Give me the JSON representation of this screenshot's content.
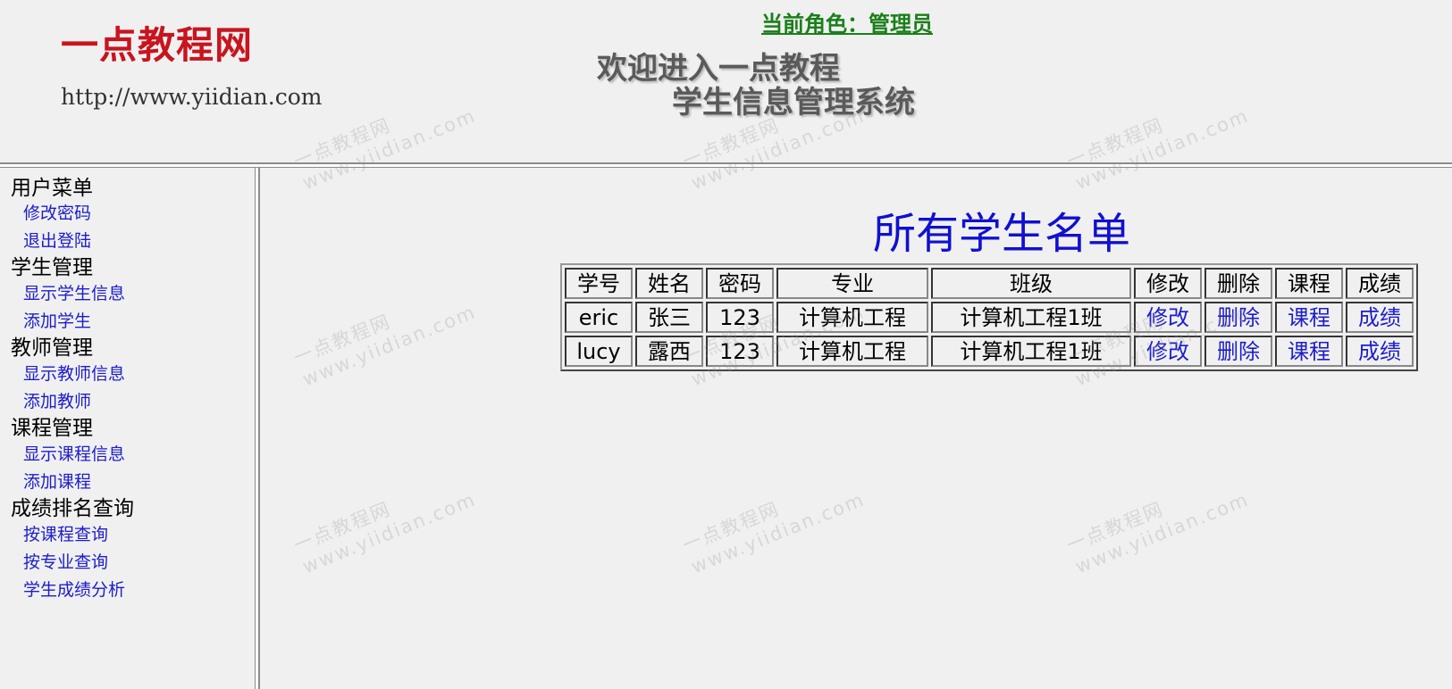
{
  "header": {
    "logo_title": "一点教程网",
    "logo_url": "http://www.yiidian.com",
    "role_label": "当前角色：管理员",
    "welcome_line1": "欢迎进入一点教程",
    "welcome_line2": "学生信息管理系统"
  },
  "menu": {
    "sections": [
      {
        "title": "用户菜单",
        "links": [
          "修改密码",
          "退出登陆"
        ]
      },
      {
        "title": "学生管理",
        "links": [
          "显示学生信息",
          "添加学生"
        ]
      },
      {
        "title": "教师管理",
        "links": [
          "显示教师信息",
          "添加教师"
        ]
      },
      {
        "title": "课程管理",
        "links": [
          "显示课程信息",
          "添加课程"
        ]
      },
      {
        "title": "成绩排名查询",
        "links": [
          "按课程查询",
          "按专业查询",
          "学生成绩分析"
        ]
      }
    ]
  },
  "main": {
    "heading": "所有学生名单",
    "table": {
      "headers": [
        "学号",
        "姓名",
        "密码",
        "专业",
        "班级",
        "修改",
        "删除",
        "课程",
        "成绩"
      ],
      "rows": [
        [
          "eric",
          "张三",
          "123",
          "计算机工程",
          "计算机工程1班",
          "修改",
          "删除",
          "课程",
          "成绩"
        ],
        [
          "lucy",
          "露西",
          "123",
          "计算机工程",
          "计算机工程1班",
          "修改",
          "删除",
          "课程",
          "成绩"
        ]
      ]
    }
  },
  "watermark": {
    "line1": "一点教程网",
    "line2": "www.yiidian.com"
  },
  "colors": {
    "logo": "#c8141e",
    "role": "#1a7f1a",
    "link": "#1c1ccc",
    "heading": "#1010d0",
    "background": "#f0f0f0"
  }
}
